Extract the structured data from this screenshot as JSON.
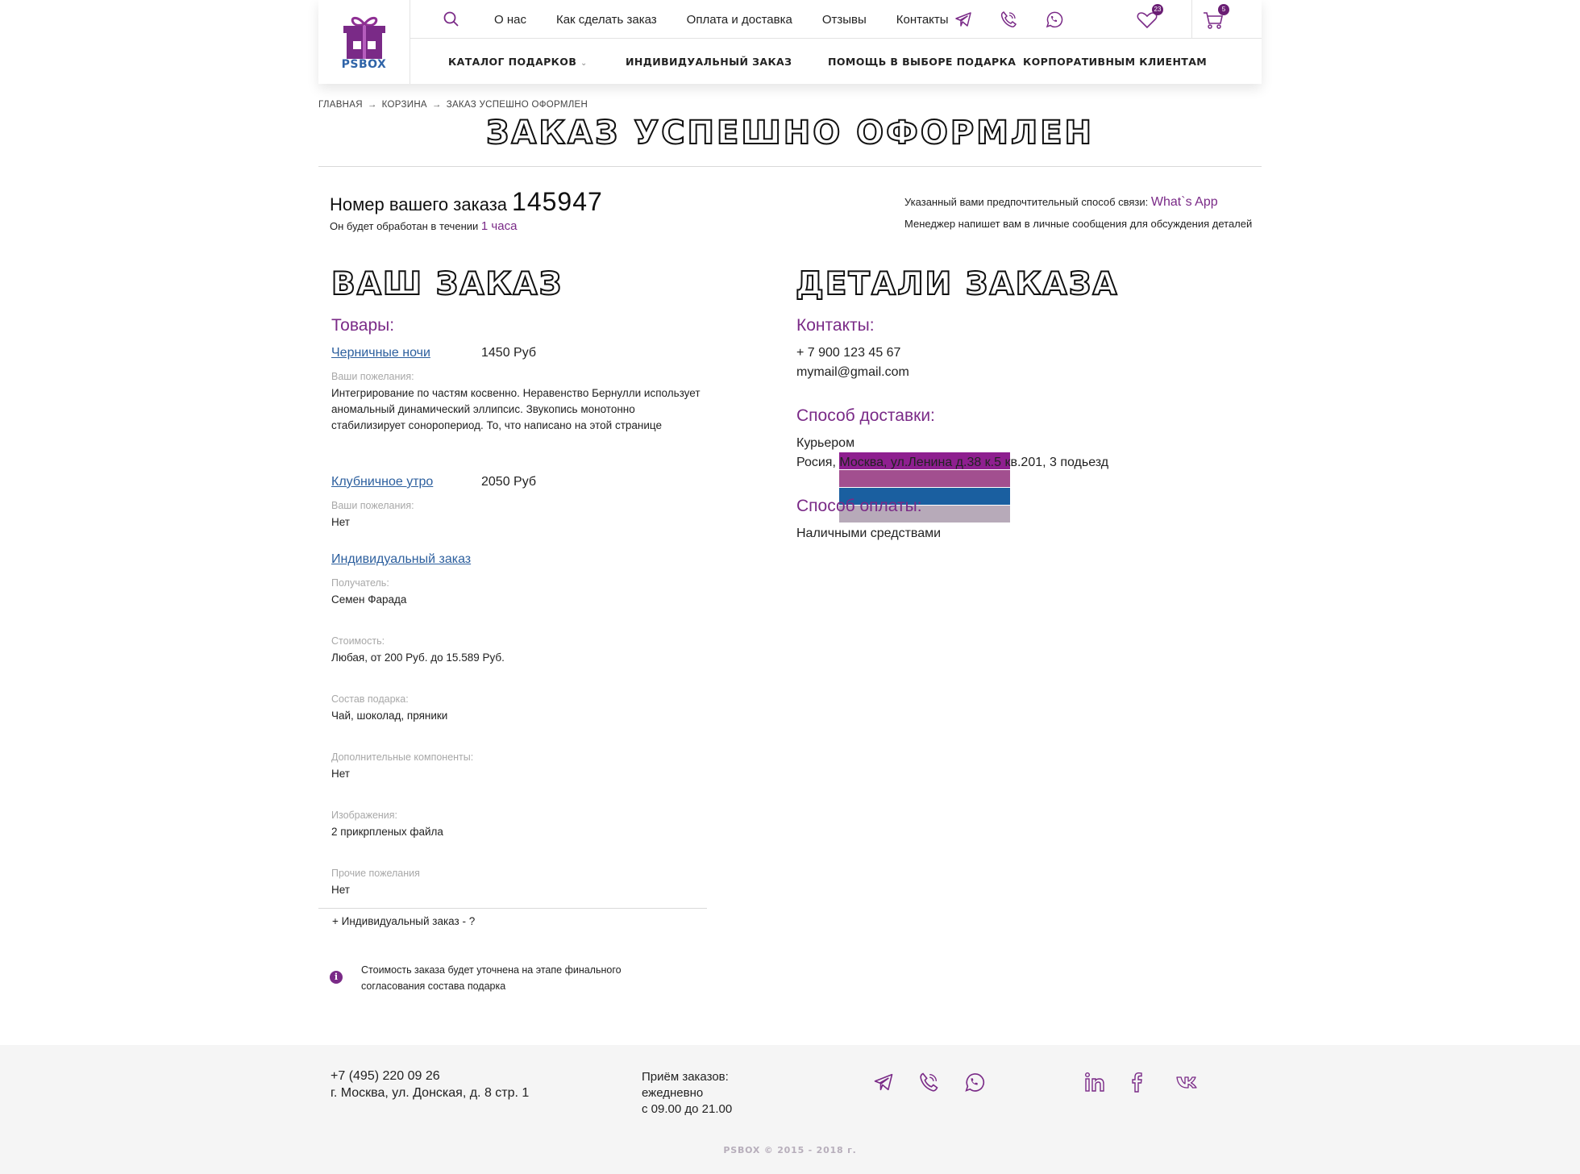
{
  "logo": {
    "text": "PSBOX"
  },
  "header": {
    "top_nav": [
      "О нас",
      "Как сделать заказ",
      "Оплата и доставка",
      "Отзывы",
      "Контакты"
    ],
    "main_nav": [
      "КАТАЛОГ ПОДАРКОВ",
      "ИНДИВИДУАЛЬНЫЙ ЗАКАЗ",
      "ПОМОЩЬ В ВЫБОРЕ ПОДАРКА",
      "КОРПОРАТИВНЫМ КЛИЕНТАМ"
    ],
    "favorites_count": "23",
    "cart_count": "5",
    "icons": [
      "search-icon",
      "telegram-icon",
      "viber-icon",
      "whatsapp-icon",
      "heart-icon",
      "cart-icon",
      "chevron-down-icon"
    ]
  },
  "breadcrumb": [
    "ГЛАВНАЯ",
    "КОРЗИНА",
    "ЗАКАЗ УСПЕШНО ОФОРМЛЕН"
  ],
  "page_title": "ЗАКАЗ УСПЕШНО ОФОРМЛЕН",
  "order": {
    "number_label": "Номер вашего заказа",
    "number": "145947",
    "processing_prefix": "Он будет обработан в течении",
    "processing_time": "1 часа",
    "contact_pref_label": "Указанный вами предпочтительный способ связи:",
    "contact_pref_value": "What`s App",
    "manager_note": "Менеджер напишет вам в личные сообщения для обсуждения деталей"
  },
  "your_order": {
    "heading": "ВАШ ЗАКАЗ",
    "goods_label": "Товары:",
    "items": [
      {
        "name": "Черничные ночи",
        "price": "1450 Руб",
        "wishes_label": "Ваши пожелания:",
        "wishes": "Интегрирование по частям косвенно. Неравенство Бернулли использует аномальный динамический эллипсис. Звукопись монотонно стабилизирует сонорoпериод. То, что написано на этой странице"
      },
      {
        "name": "Клубничное утро",
        "price": "2050 Руб",
        "wishes_label": "Ваши пожелания:",
        "wishes": "Нет"
      }
    ],
    "custom": {
      "name": "Индивидуальный заказ",
      "fields": [
        {
          "label": "Получатель:",
          "value": "Семен Фарада"
        },
        {
          "label": "Стоимость:",
          "value": "Любая, от 200 Руб. до 15.589 Руб."
        },
        {
          "label": "Состав подарка:",
          "value": "Чай, шоколад, пряники"
        },
        {
          "label": "Дополнительные компоненты:",
          "value": "Нет"
        },
        {
          "label": "Изображения:",
          "value": "2 прикрпленых файла"
        },
        {
          "label": "Прочие пожелания",
          "value": "Нет"
        }
      ]
    },
    "extra_line": "+ Индивидуальный заказ - ?",
    "info_note": "Стоимость заказа будет уточнена на этапе финального согласования состава подарка"
  },
  "details": {
    "heading": "ДЕТАЛИ ЗАКАЗА",
    "contacts_label": "Контакты:",
    "phone": "+ 7 900 123 45 67",
    "email": "mymail@gmail.com",
    "delivery_label": "Способ доставки:",
    "delivery_method": "Курьером",
    "delivery_address": "Росия, Москва, ул.Ленина д.38 к.5 кв.201, 3 подьезд",
    "payment_label": "Способ оплаты:",
    "payment_method": "Наличными средствами"
  },
  "palette_swatches": [
    "#8e1f8f",
    "#a24f8f",
    "#1a5fa0",
    "#b7aab9"
  ],
  "footer": {
    "phone": "+7 (495) 220 09 26",
    "address": "г. Москва, ул. Донская, д. 8 стр. 1",
    "hours": [
      "Приём заказов:",
      "ежедневно",
      "с 09.00 до 21.00"
    ],
    "copyright": "PSBOX © 2015 - 2018 г.",
    "icons": [
      "telegram-icon",
      "viber-icon",
      "whatsapp-icon",
      "linkedin-icon",
      "facebook-icon",
      "vk-icon"
    ]
  },
  "colors": {
    "accent": "#7a2a87",
    "link": "#2c5f9e",
    "logo_blue": "#2f64a8"
  }
}
